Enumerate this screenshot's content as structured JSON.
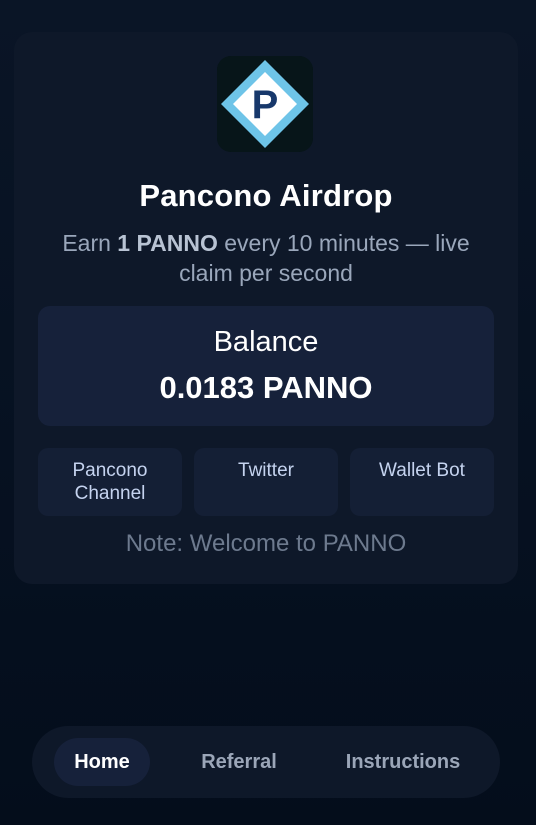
{
  "app": {
    "title": "Pancono Airdrop",
    "logo_letter": "P",
    "subtitle": {
      "prefix": "Earn ",
      "amount": "1 PANNO",
      "suffix": " every 10 minutes — live claim per second"
    }
  },
  "balance": {
    "label": "Balance",
    "value": "0.0183 PANNO"
  },
  "links": [
    {
      "label": "Pancono Channel"
    },
    {
      "label": "Twitter"
    },
    {
      "label": "Wallet Bot"
    }
  ],
  "note": "Note: Welcome to PANNO",
  "nav": {
    "active": "Home",
    "items": [
      {
        "label": "Home"
      },
      {
        "label": "Referral"
      },
      {
        "label": "Instructions"
      }
    ]
  },
  "colors": {
    "background": "#061121",
    "card": "#0e1829",
    "panel": "#16213a",
    "logo_diamond": "#6ec4e8",
    "logo_letter": "#17386b"
  }
}
